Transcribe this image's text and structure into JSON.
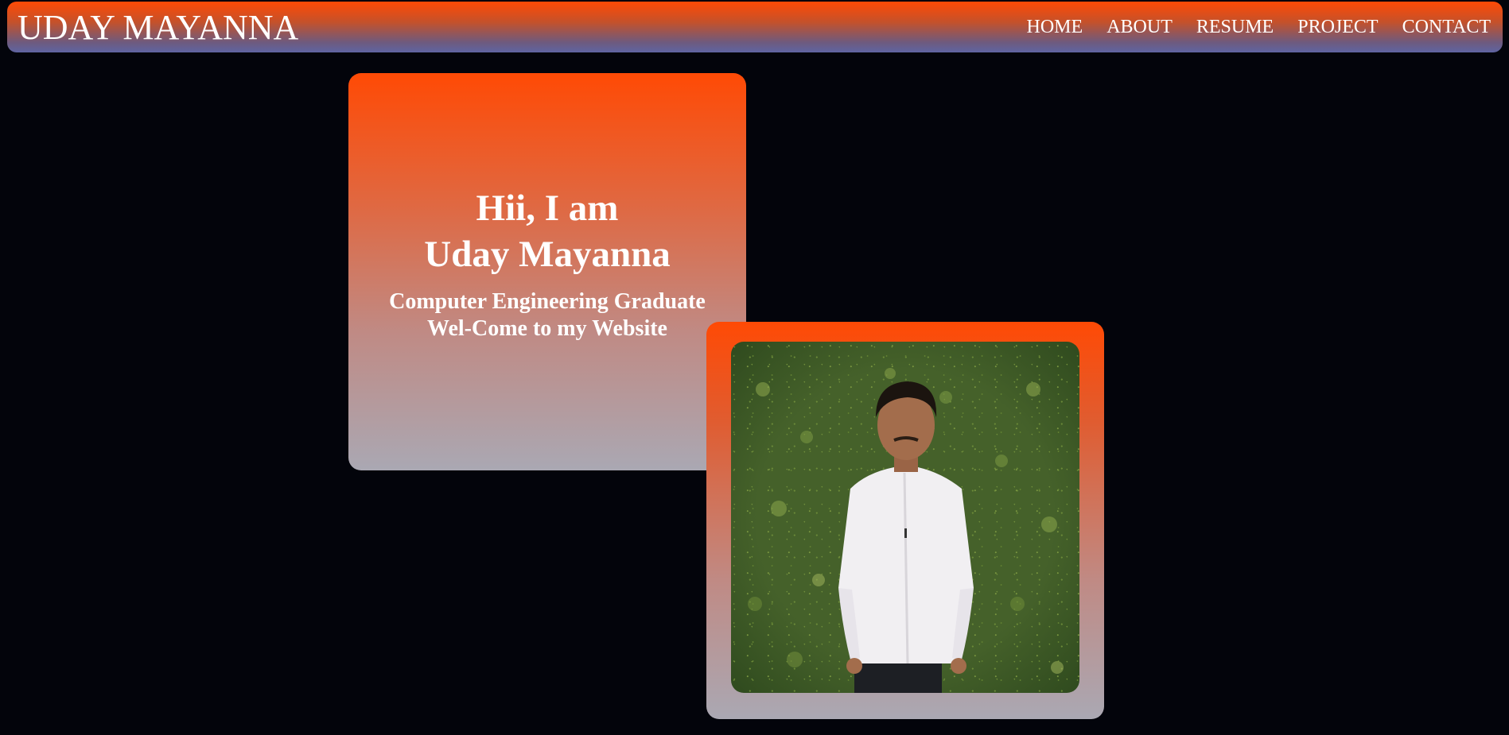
{
  "header": {
    "brand": "UDAY MAYANNA",
    "nav": [
      {
        "label": "HOME"
      },
      {
        "label": "ABOUT"
      },
      {
        "label": "RESUME"
      },
      {
        "label": "PROJECT"
      },
      {
        "label": "CONTACT"
      }
    ]
  },
  "hero": {
    "greeting": "Hii, I am",
    "name": "Uday Mayanna",
    "subtitle_line1": "Computer Engineering Graduate",
    "subtitle_line2": "Wel-Come to my Website"
  },
  "photo": {
    "alt": "profile-photo"
  },
  "colors": {
    "background": "#03040b",
    "accent_orange": "#ff4a05",
    "gradient_bottom": "#aaa8b3",
    "nav_bottom": "#5f64a2",
    "text": "#ffffff"
  }
}
